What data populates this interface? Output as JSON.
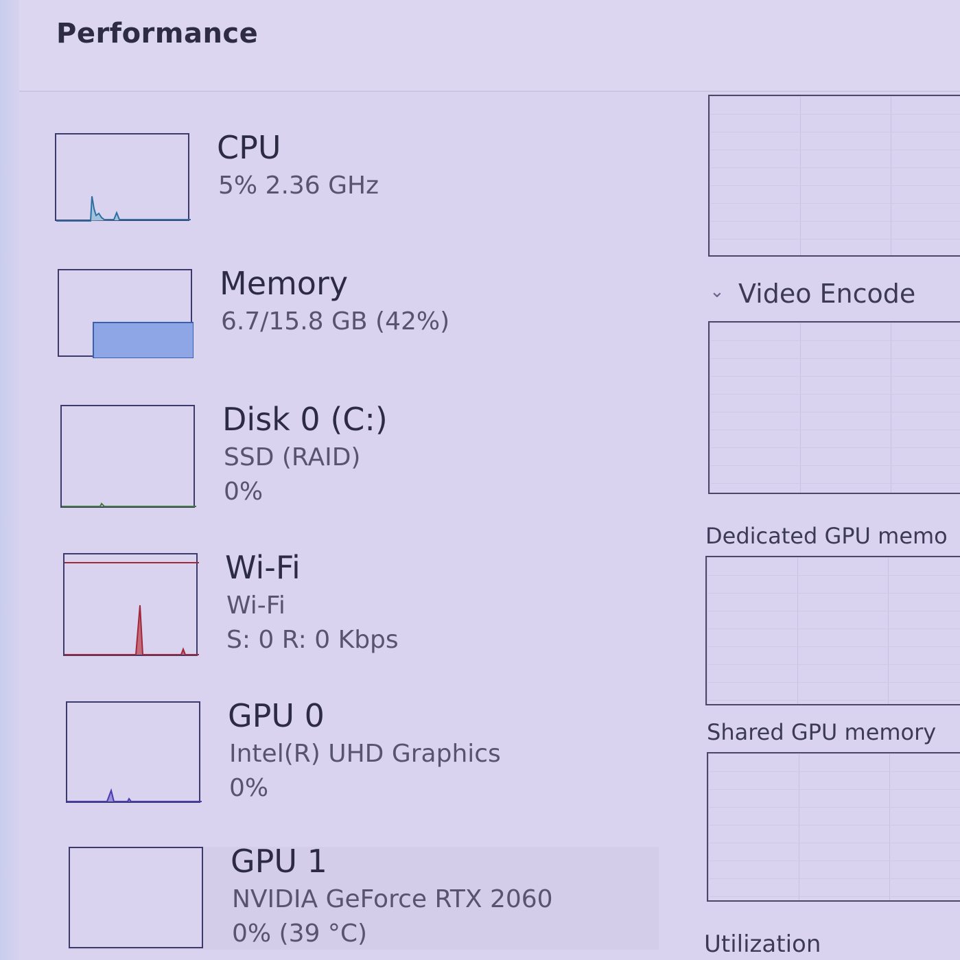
{
  "header": {
    "title": "Performance"
  },
  "items": [
    {
      "title": "CPU",
      "sub1": "5% 2.36 GHz",
      "sub2": "",
      "graph_color": "#2f6f9f"
    },
    {
      "title": "Memory",
      "sub1": "6.7/15.8 GB (42%)",
      "sub2": "",
      "graph_color": "#3a5fb0",
      "fill_fraction": 0.42
    },
    {
      "title": "Disk 0 (C:)",
      "sub1": "SSD (RAID)",
      "sub2": "0%",
      "graph_color": "#3f7a3a"
    },
    {
      "title": "Wi-Fi",
      "sub1": "Wi-Fi",
      "sub2": "S: 0 R: 0 Kbps",
      "graph_color": "#a0283a"
    },
    {
      "title": "GPU 0",
      "sub1": "Intel(R) UHD Graphics",
      "sub2": "0%",
      "graph_color": "#4a3ab0"
    },
    {
      "title": "GPU 1",
      "sub1": "NVIDIA GeForce RTX 2060",
      "sub2": "0% (39 °C)",
      "graph_color": "#3a3a6a"
    }
  ],
  "right": {
    "video_encode": "Video Encode",
    "dedicated_gpu_memory": "Dedicated GPU memo",
    "shared_gpu_memory": "Shared GPU memory",
    "utilization": "Utilization"
  },
  "icons": {
    "collapse": "chevron-down-icon"
  }
}
